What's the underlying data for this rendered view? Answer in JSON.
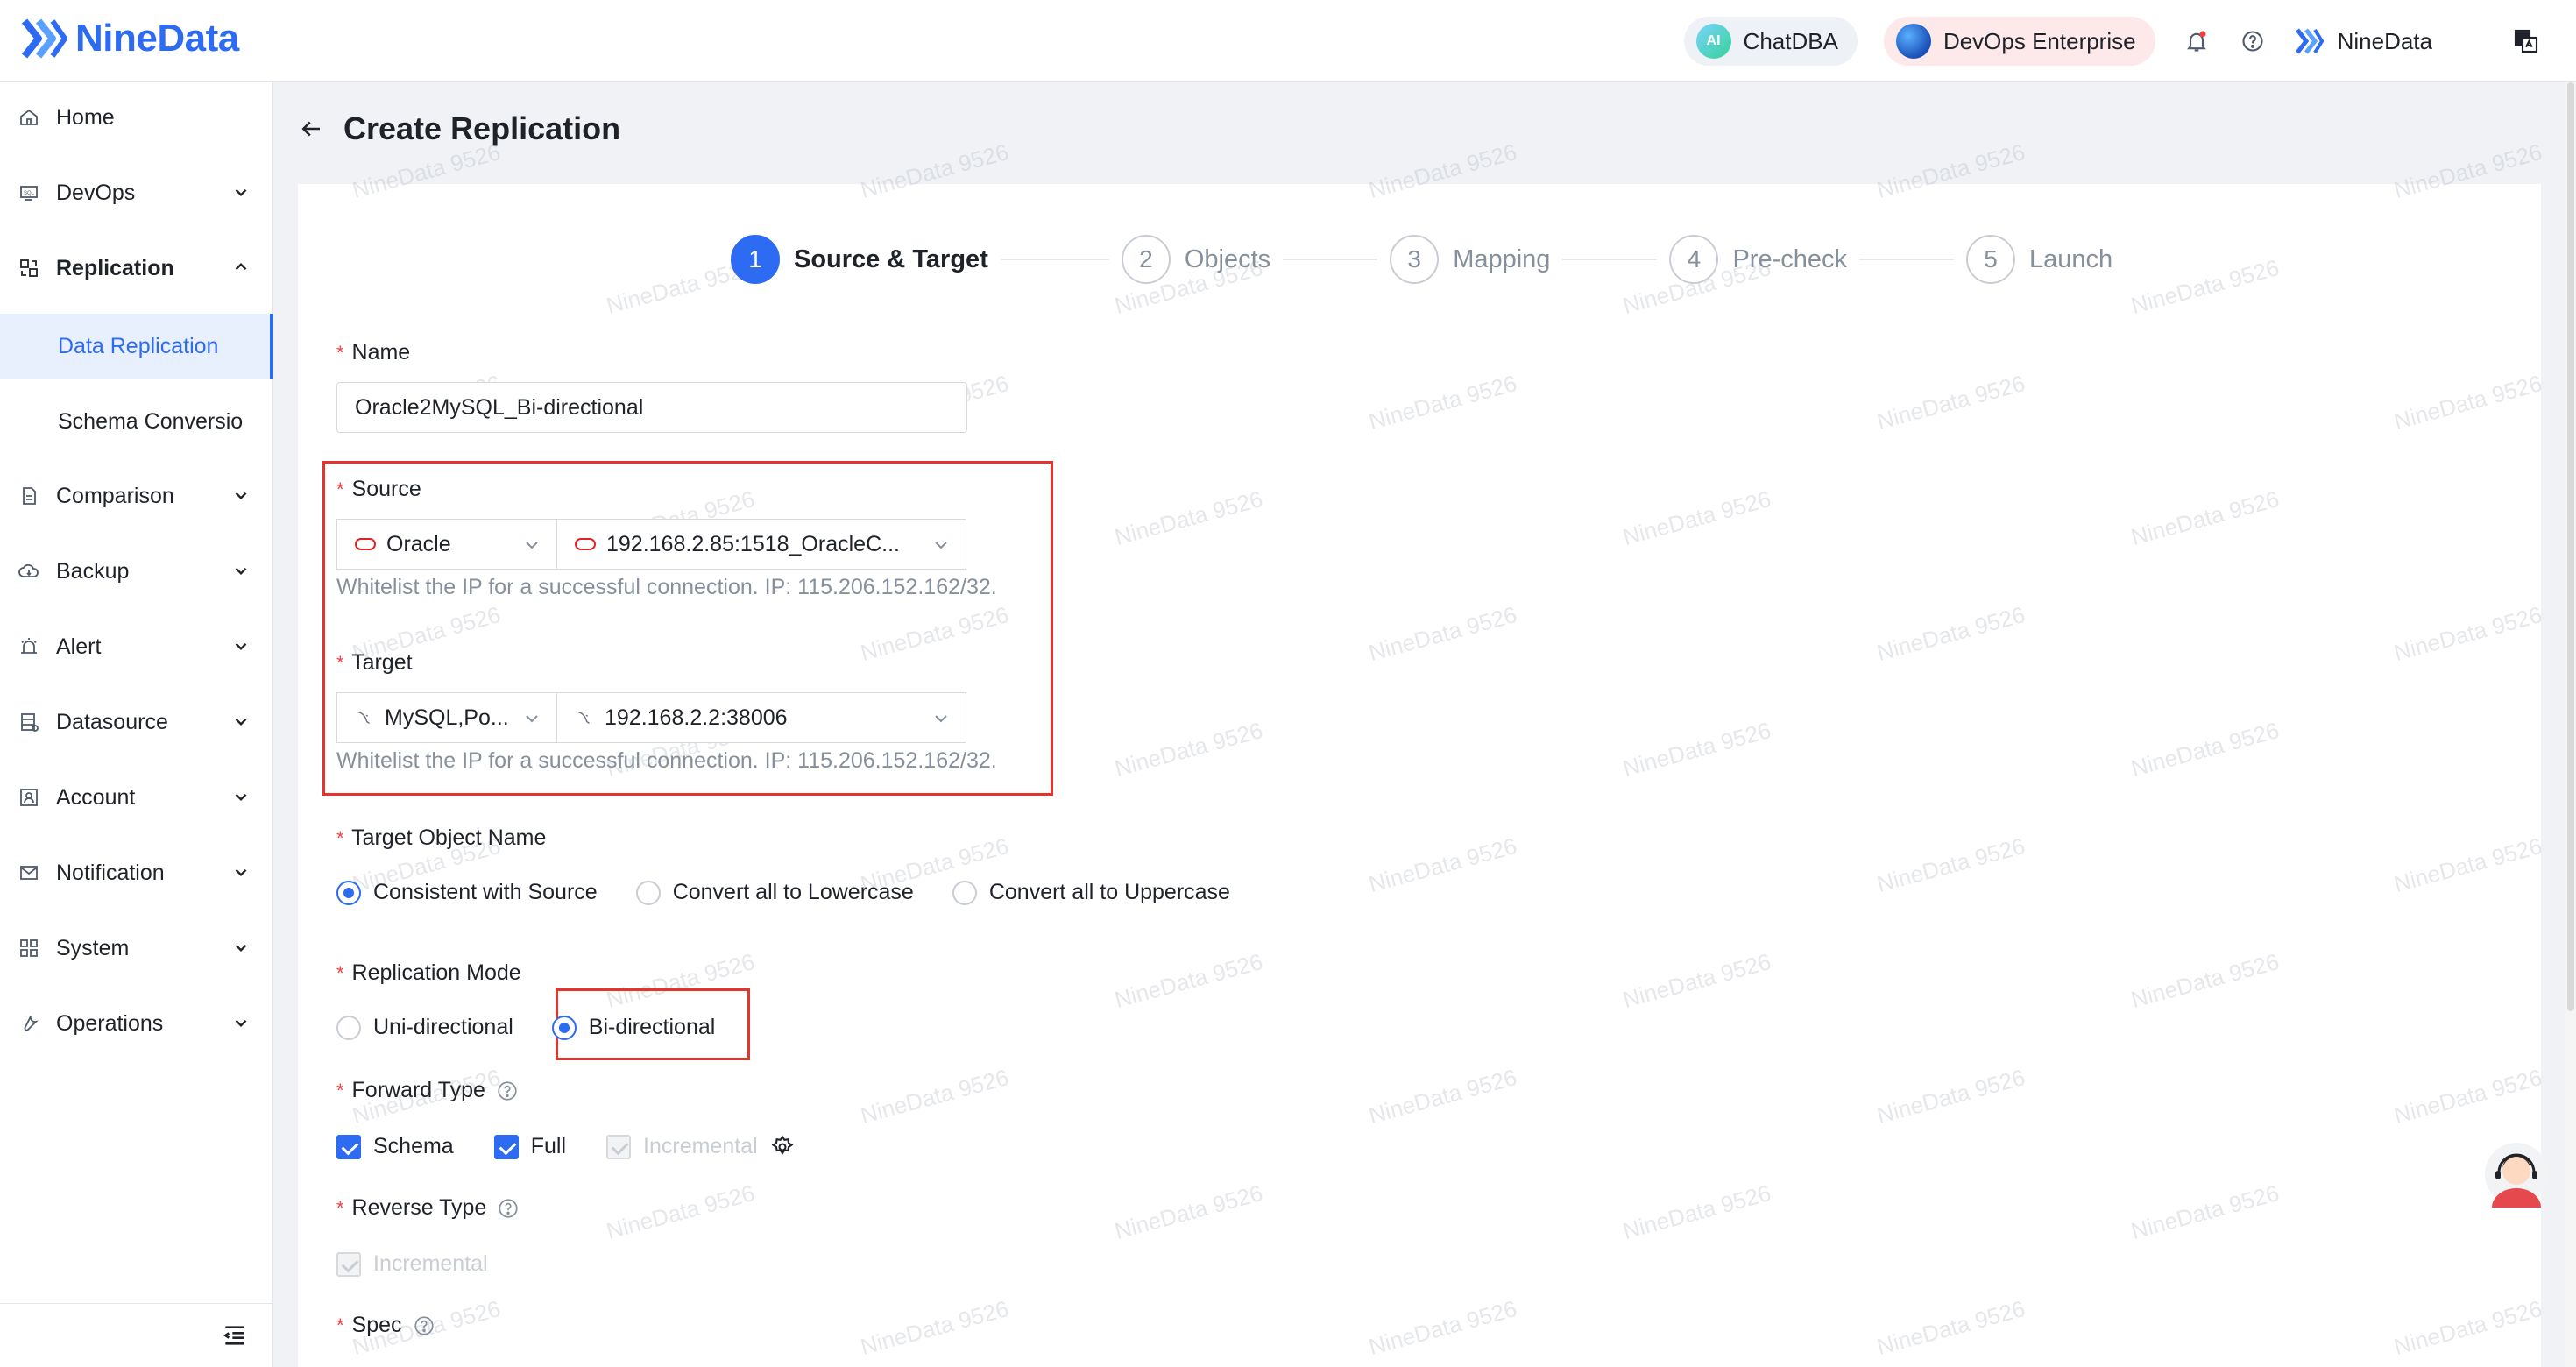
{
  "header": {
    "brand": "NineData",
    "chatdba_label": "ChatDBA",
    "chatdba_icon": "AI",
    "devops_label": "DevOps Enterprise",
    "user_name": "NineData"
  },
  "sidebar": {
    "items": [
      {
        "label": "Home",
        "icon": "home-icon"
      },
      {
        "label": "DevOps",
        "icon": "sql-icon"
      },
      {
        "label": "Replication",
        "icon": "replication-icon"
      },
      {
        "label": "Comparison",
        "icon": "compare-icon"
      },
      {
        "label": "Backup",
        "icon": "cloud-icon"
      },
      {
        "label": "Alert",
        "icon": "alarm-icon"
      },
      {
        "label": "Datasource",
        "icon": "database-icon"
      },
      {
        "label": "Account",
        "icon": "account-icon"
      },
      {
        "label": "Notification",
        "icon": "mail-icon"
      },
      {
        "label": "System",
        "icon": "grid-icon"
      },
      {
        "label": "Operations",
        "icon": "wrench-icon"
      }
    ],
    "sub_items": [
      {
        "label": "Data Replication"
      },
      {
        "label": "Schema Conversio"
      }
    ]
  },
  "page": {
    "title": "Create Replication"
  },
  "steps": [
    {
      "num": "1",
      "label": "Source & Target"
    },
    {
      "num": "2",
      "label": "Objects"
    },
    {
      "num": "3",
      "label": "Mapping"
    },
    {
      "num": "4",
      "label": "Pre-check"
    },
    {
      "num": "5",
      "label": "Launch"
    }
  ],
  "form": {
    "name_label": "Name",
    "name_value": "Oracle2MySQL_Bi-directional",
    "source_label": "Source",
    "source_type": "Oracle",
    "source_instance": "192.168.2.85:1518_OracleC...",
    "source_hint": "Whitelist the IP for a successful connection. IP: 115.206.152.162/32.",
    "target_label": "Target",
    "target_type": "MySQL,Po...",
    "target_instance": "192.168.2.2:38006",
    "target_hint": "Whitelist the IP for a successful connection. IP: 115.206.152.162/32.",
    "target_object_label": "Target Object Name",
    "target_object_options": [
      "Consistent with Source",
      "Convert all to Lowercase",
      "Convert all to Uppercase"
    ],
    "mode_label": "Replication Mode",
    "mode_options": [
      "Uni-directional",
      "Bi-directional"
    ],
    "forward_label": "Forward Type",
    "forward_options": [
      "Schema",
      "Full",
      "Incremental"
    ],
    "reverse_label": "Reverse Type",
    "reverse_options": [
      "Incremental"
    ],
    "spec_label": "Spec"
  },
  "watermark": "NineData 9526",
  "colors": {
    "accent": "#2c6bf2",
    "highlight": "#e5342c",
    "required": "#f53f3f"
  }
}
